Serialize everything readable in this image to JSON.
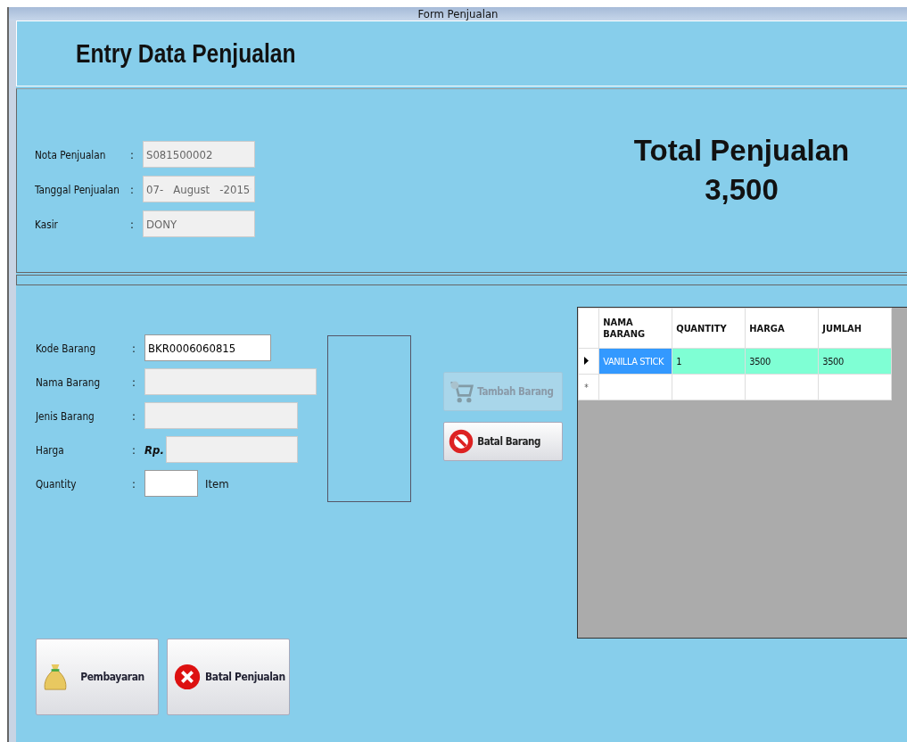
{
  "window": {
    "title": "Form Penjualan"
  },
  "header": {
    "title": "Entry Data Penjualan"
  },
  "sale_info": {
    "fields": [
      {
        "label": "Nota Penjualan",
        "colon": ":",
        "kind": "readonly",
        "value": "S081500002"
      },
      {
        "label": "Tanggal Penjualan",
        "colon": ":",
        "kind": "date",
        "value": "07-   August   -2015"
      },
      {
        "label": "Kasir",
        "colon": ":",
        "kind": "readonly",
        "value": "DONY"
      }
    ]
  },
  "total": {
    "label": "Total Penjualan",
    "value": "3,500"
  },
  "item_form": {
    "fields": [
      {
        "label": "Kode Barang",
        "colon": ":",
        "kind": "input",
        "value": "BKR0006060815"
      },
      {
        "label": "Nama Barang",
        "colon": ":",
        "kind": "readonly"
      },
      {
        "label": "Jenis Barang",
        "colon": ":",
        "kind": "readonly"
      },
      {
        "label": "Harga",
        "colon": ":",
        "kind": "readonly",
        "prefix": "Rp."
      },
      {
        "label": "Quantity",
        "colon": ":",
        "kind": "input",
        "suffix": "Item"
      }
    ]
  },
  "item_buttons": [
    {
      "label": "Tambah Barang",
      "kind": "cart",
      "disabled": true
    },
    {
      "label": "Batal Barang",
      "kind": "cancel",
      "disabled": false
    }
  ],
  "table": {
    "columns": [
      "NAMA BARANG",
      "QUANTITY",
      "HARGA",
      "JUMLAH"
    ],
    "rows": [
      {
        "current": true,
        "cells": [
          {
            "text": "VANILLA STICK",
            "selected": true
          },
          {
            "text": "1",
            "selected": false
          },
          {
            "text": "3500",
            "selected": false
          },
          {
            "text": "3500",
            "selected": false
          }
        ]
      }
    ],
    "new_row_marker": "*"
  },
  "bottom_buttons": [
    {
      "label": "Pembayaran",
      "kind": "money"
    },
    {
      "label": "Batal Penjualan",
      "kind": "close"
    }
  ]
}
